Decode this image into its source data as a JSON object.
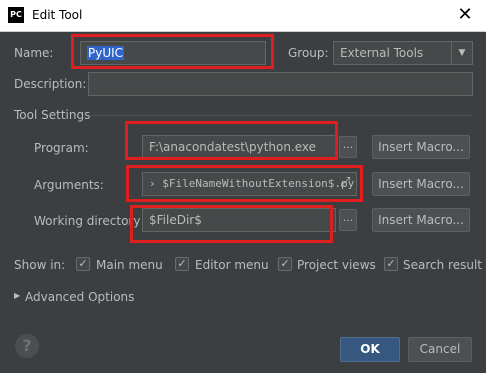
{
  "window": {
    "app_icon": "PC",
    "title": "Edit Tool",
    "close_glyph": "✕"
  },
  "form": {
    "name_label": "Name:",
    "name_value": "PyUIC",
    "group_label": "Group:",
    "group_value": "External Tools",
    "description_label": "Description:",
    "description_value": ""
  },
  "tool_settings": {
    "section_label": "Tool Settings",
    "program_label": "Program:",
    "program_value": "F:\\anacondatest\\python.exe",
    "arguments_label": "Arguments:",
    "arguments_value": "› $FileNameWithoutExtension$.py",
    "expand_glyph": "⤢",
    "working_dir_label": "Working directory",
    "working_dir_value": "$FileDir$",
    "browse_glyph": "...",
    "insert_macro_label": "Insert Macro..."
  },
  "show_in": {
    "label": "Show in:",
    "options": [
      {
        "label": "Main menu",
        "checked": true
      },
      {
        "label": "Editor menu",
        "checked": true
      },
      {
        "label": "Project views",
        "checked": true
      },
      {
        "label": "Search result",
        "checked": true
      }
    ]
  },
  "advanced": {
    "label": "Advanced Options"
  },
  "footer": {
    "help_glyph": "?",
    "ok_label": "OK",
    "cancel_label": "Cancel"
  },
  "colors": {
    "dialog_bg": "#3c3f41",
    "field_bg": "#45494a",
    "selection": "#2f65ca",
    "highlight_box": "#e01e1e",
    "ok_button": "#365880"
  },
  "icons": {
    "dropdown": "chevron-down-icon",
    "expand": "expand-icon",
    "advanced": "triangle-right-icon",
    "help": "help-icon",
    "close": "close-icon"
  }
}
